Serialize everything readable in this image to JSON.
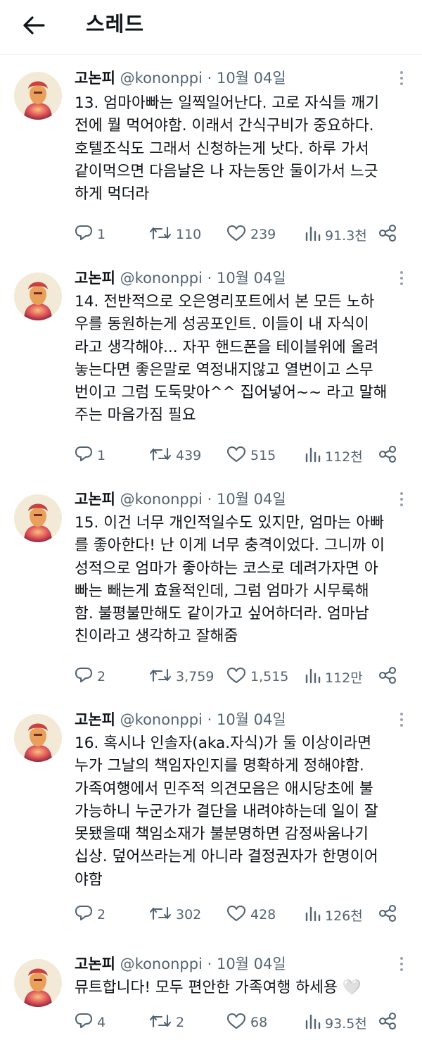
{
  "header": {
    "title": "스레드"
  },
  "tweets": [
    {
      "name": "고논피",
      "handle": "@kononppi",
      "sep": "·",
      "date": "10월 04일",
      "lines": [
        "13. 엄마아빠는 일찍일어난다. 고로 자식들 깨기",
        "전에 뭘 먹어야함. 이래서 간식구비가 중요하다.",
        "호텔조식도 그래서 신청하는게 낫다. 하루 가서",
        "같이먹으면 다음날은 나 자는동안 둘이가서 느긋",
        "하게 먹더라"
      ],
      "replies": "1",
      "retweets": "110",
      "likes": "239",
      "views": "91.3천"
    },
    {
      "name": "고논피",
      "handle": "@kononppi",
      "sep": "·",
      "date": "10월 04일",
      "lines": [
        "14. 전반적으로 오은영리포트에서 본 모든 노하",
        "우를 동원하는게 성공포인트. 이들이 내 자식이",
        "라고 생각해야... 자꾸 핸드폰을 테이블위에 올려",
        "놓는다면 좋은말로 역정내지않고 열번이고 스무",
        "번이고 그럼 도둑맞아^^ 집어넣어~~ 라고 말해",
        "주는 마음가짐 필요"
      ],
      "replies": "1",
      "retweets": "439",
      "likes": "515",
      "views": "112천"
    },
    {
      "name": "고논피",
      "handle": "@kononppi",
      "sep": "·",
      "date": "10월 04일",
      "lines": [
        "15. 이건 너무 개인적일수도 있지만, 엄마는 아빠",
        "를 좋아한다! 난 이게 너무 충격이었다. 그니까 이",
        "성적으로 엄마가 좋아하는 코스로 데려가자면 아",
        "빠는 빼는게 효율적인데, 그럼 엄마가 시무룩해",
        "함. 불평불만해도 같이가고 싶어하더라. 엄마남",
        "친이라고 생각하고 잘해줌"
      ],
      "replies": "2",
      "retweets": "3,759",
      "likes": "1,515",
      "views": "112만"
    },
    {
      "name": "고논피",
      "handle": "@kononppi",
      "sep": "·",
      "date": "10월 04일",
      "lines": [
        "16. 혹시나 인솔자(aka.자식)가 둘 이상이라면",
        "누가 그날의 책임자인지를 명확하게 정해야함.",
        "가족여행에서 민주적 의견모음은 애시당초에 불",
        "가능하니 누군가가 결단을 내려야하는데 일이 잘",
        "못됐을때 책임소재가 불분명하면 감정싸움나기",
        "십상. 덮어쓰라는게 아니라 결정권자가 한명이어",
        "야함"
      ],
      "replies": "2",
      "retweets": "302",
      "likes": "428",
      "views": "126천"
    },
    {
      "name": "고논피",
      "handle": "@kononppi",
      "sep": "·",
      "date": "10월 04일",
      "lines": [
        "뮤트합니다! 모두 편안한 가족여행 하세용 🤍"
      ],
      "replies": "4",
      "retweets": "2",
      "likes": "68",
      "views": "93.5천"
    }
  ]
}
